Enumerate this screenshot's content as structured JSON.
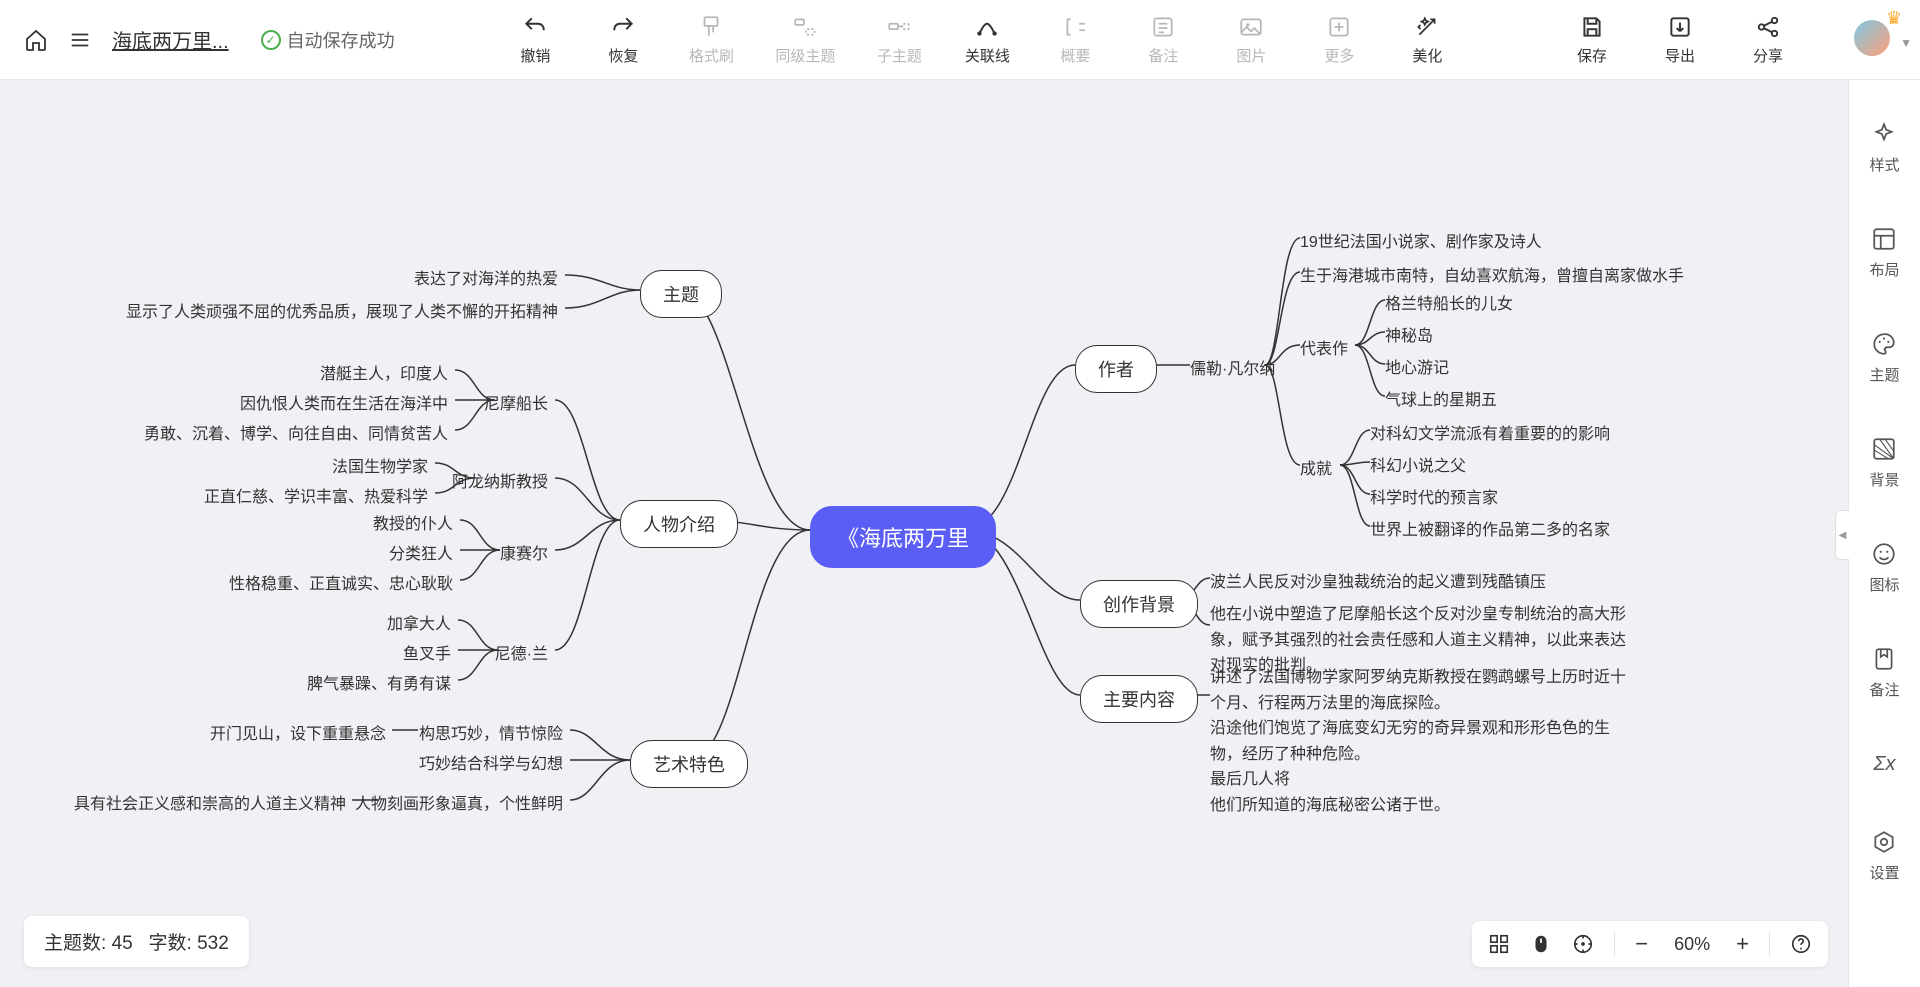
{
  "header": {
    "title": "海底两万里...",
    "autosave": "自动保存成功"
  },
  "toolbar": {
    "undo": "撤销",
    "redo": "恢复",
    "formatBrush": "格式刷",
    "siblingTopic": "同级主题",
    "childTopic": "子主题",
    "relation": "关联线",
    "summary": "概要",
    "note": "备注",
    "image": "图片",
    "more": "更多",
    "beautify": "美化",
    "save": "保存",
    "export": "导出",
    "share": "分享"
  },
  "rightbar": {
    "style": "样式",
    "layout": "布局",
    "theme": "主题",
    "background": "背景",
    "icon": "图标",
    "noteR": "备注",
    "formula": "Σx",
    "settings": "设置"
  },
  "status": {
    "topicsLabel": "主题数:",
    "topicsValue": "45",
    "wordsLabel": "字数:",
    "wordsValue": "532"
  },
  "zoom": {
    "minus": "−",
    "plus": "+",
    "pct": "60%"
  },
  "mindmap": {
    "root": "《海底两万里",
    "left": {
      "theme": {
        "label": "主题",
        "leaves": [
          "表达了对海洋的热爱",
          "显示了人类顽强不屈的优秀品质，展现了人类不懈的开拓精神"
        ]
      },
      "characters": {
        "label": "人物介绍",
        "nemo": {
          "label": "尼摩船长",
          "leaves": [
            "潜艇主人，印度人",
            "因仇恨人类而在生活在海洋中",
            "勇敢、沉着、博学、向往自由、同情贫苦人"
          ]
        },
        "aronnax": {
          "label": "阿龙纳斯教授",
          "leaves": [
            "法国生物学家",
            "正直仁慈、学识丰富、热爱科学"
          ]
        },
        "conseil": {
          "label": "康赛尔",
          "leaves": [
            "教授的仆人",
            "分类狂人",
            "性格稳重、正直诚实、忠心耿耿"
          ]
        },
        "ned": {
          "label": "尼德·兰",
          "leaves": [
            "加拿大人",
            "鱼叉手",
            "脾气暴躁、有勇有谋"
          ]
        }
      },
      "art": {
        "label": "艺术特色",
        "leaves": [
          {
            "main": "构思巧妙，情节惊险",
            "sub": "开门见山，设下重重悬念"
          },
          {
            "main": "巧妙结合科学与幻想",
            "sub": ""
          },
          {
            "main": "人物刻画形象逼真，个性鲜明",
            "sub": "具有社会正义感和崇高的人道主义精神"
          }
        ]
      }
    },
    "right": {
      "author": {
        "label": "作者",
        "name": "儒勒·凡尔纳",
        "bio": [
          "19世纪法国小说家、剧作家及诗人",
          "生于海港城市南特，自幼喜欢航海，曾擅自离家做水手"
        ],
        "works": {
          "label": "代表作",
          "items": [
            "格兰特船长的儿女",
            "神秘岛",
            "地心游记",
            "气球上的星期五"
          ]
        },
        "achv": {
          "label": "成就",
          "items": [
            "对科幻文学流派有着重要的的影响",
            "科幻小说之父",
            "科学时代的预言家",
            "世界上被翻译的作品第二多的名家"
          ]
        }
      },
      "background": {
        "label": "创作背景",
        "items": [
          "波兰人民反对沙皇独裁统治的起义遭到残酷镇压",
          "他在小说中塑造了尼摩船长这个反对沙皇专制统治的高大形象，赋予其强烈的社会责任感和人道主义精神，以此来表达对现实的批判。"
        ]
      },
      "content": {
        "label": "主要内容",
        "text": "讲述了法国博物学家阿罗纳克斯教授在鹦鹉螺号上历时近十个月、行程两万法里的海底探险。\n沿途他们饱览了海底变幻无穷的奇异景观和形形色色的生物，经历了种种危险。\n最后几人将\n他们所知道的海底秘密公诸于世。"
      }
    }
  }
}
